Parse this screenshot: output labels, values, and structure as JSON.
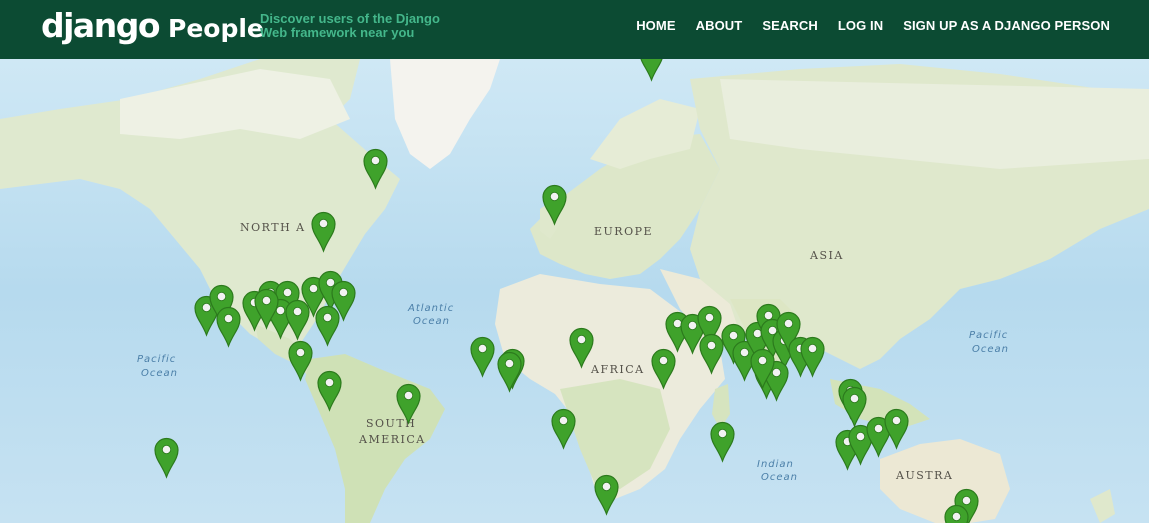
{
  "header": {
    "logo_primary": "django",
    "logo_secondary": "People",
    "tagline_line1": "Discover users of the Django",
    "tagline_line2": "Web framework near you",
    "nav": [
      {
        "label": "HOME"
      },
      {
        "label": "ABOUT"
      },
      {
        "label": "SEARCH"
      },
      {
        "label": "LOG IN"
      },
      {
        "label": "SIGN UP AS A DJANGO PERSON"
      }
    ]
  },
  "map": {
    "continent_labels": {
      "north_america": "NORTH A",
      "europe": "EUROPE",
      "asia": "ASIA",
      "africa": "AFRICA",
      "south_america_1": "SOUTH",
      "south_america_2": "AMERICA",
      "australia": "AUSTRA"
    },
    "ocean_labels": {
      "atlantic_1": "Atlantic",
      "atlantic_2": "Ocean",
      "pacific_w_1": "Pacific",
      "pacific_w_2": "Ocean",
      "pacific_e_1": "Pacific",
      "pacific_e_2": "Ocean",
      "indian_1": "Indian",
      "indian_2": "Ocean"
    },
    "marker_color": "#3fa22b",
    "marker_dark": "#2c7a1d",
    "marker_icon": "map-pin-icon"
  }
}
